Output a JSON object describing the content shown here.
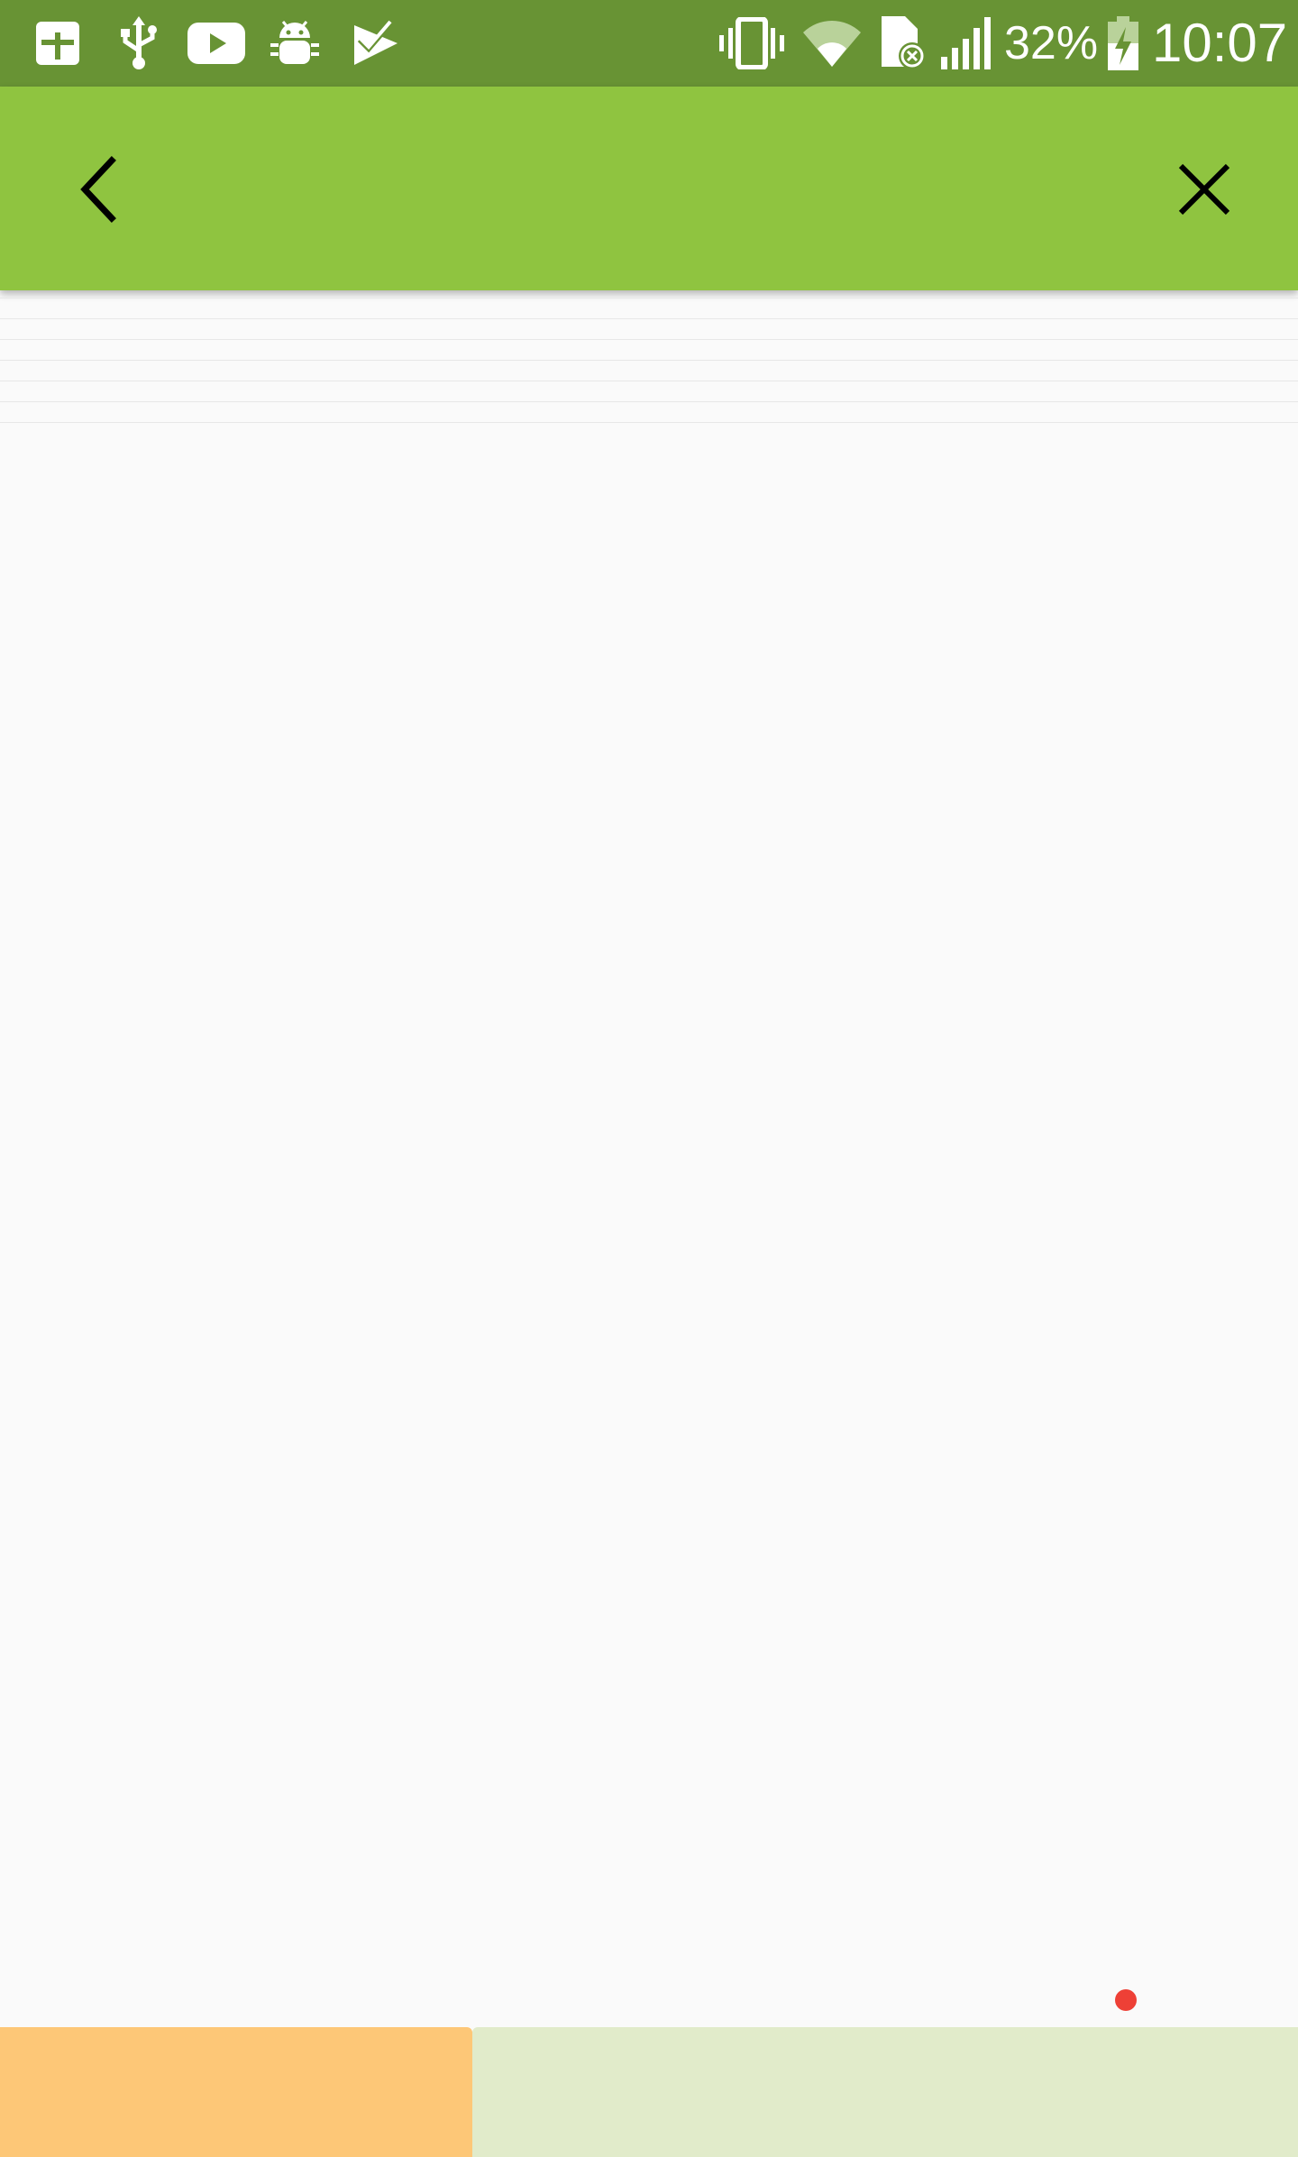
{
  "status_bar": {
    "battery_percent": "32%",
    "time": "10:07",
    "left_icons": [
      "calculator-icon",
      "usb-icon",
      "youtube-icon",
      "android-debug-icon",
      "task-check-icon"
    ],
    "right_icons": [
      "vibrate-icon",
      "wifi-icon",
      "no-sim-icon",
      "signal-icon",
      "battery-charging-icon"
    ]
  },
  "app_bar": {
    "back_icon": "chevron-left-icon",
    "close_icon": "close-icon"
  },
  "colors": {
    "status_bar": "#689334",
    "app_bar": "#8fc440",
    "background": "#fafafa",
    "bottom_left_button": "#fdc777",
    "bottom_right_button": "#e1ebca",
    "indicator_dot": "#ee4036"
  }
}
